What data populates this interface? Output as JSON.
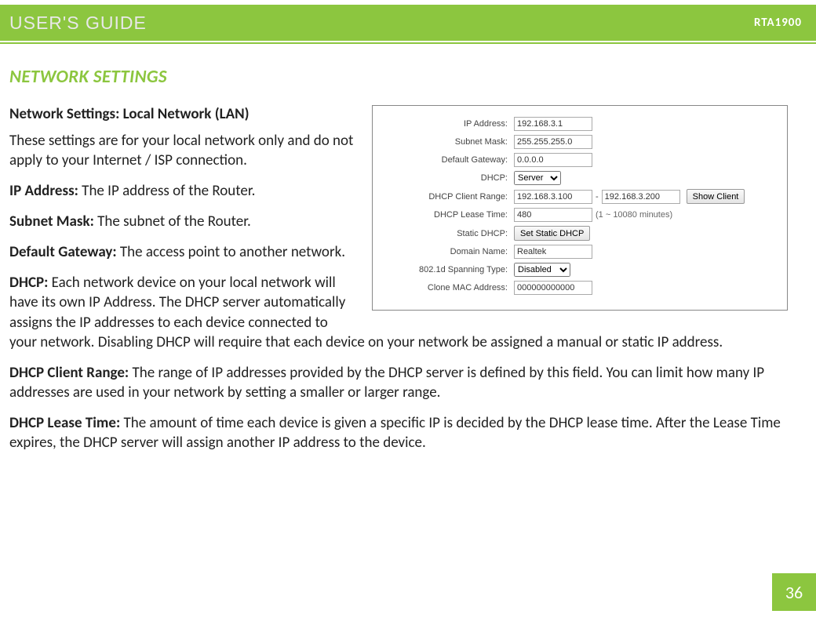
{
  "header": {
    "title": "USER'S GUIDE",
    "model": "RTA1900"
  },
  "section_title": "NETWORK SETTINGS",
  "subheading": "Network Settings: Local Network (LAN)",
  "intro": "These settings are for your local network only and do not apply to your Internet / ISP connection.",
  "defs": {
    "ip_term": "IP Address:",
    "ip_text": " The IP address of the Router.",
    "subnet_term": "Subnet Mask:",
    "subnet_text": " The subnet of the Router.",
    "gateway_term": "Default Gateway:",
    "gateway_text": " The access point to another network.",
    "dhcp_term": "DHCP:",
    "dhcp_text": " Each network device on your local network will have its own IP Address.  The DHCP server automatically assigns the IP addresses to each device connected to your network.  Disabling DHCP will require that each device on your network be assigned a manual or static IP address.",
    "range_term": "DHCP Client Range:",
    "range_text": " The range of IP addresses provided by the DHCP server is defined by this field.  You can limit how many IP addresses are used in your network by setting a smaller or larger range.",
    "lease_term": "DHCP Lease Time:",
    "lease_text": " The amount of time each device is given a specific IP is decided by the DHCP lease time.  After the Lease Time expires, the DHCP server will assign another IP address to the device."
  },
  "form": {
    "ip_label": "IP Address:",
    "ip_value": "192.168.3.1",
    "subnet_label": "Subnet Mask:",
    "subnet_value": "255.255.255.0",
    "gateway_label": "Default Gateway:",
    "gateway_value": "0.0.0.0",
    "dhcp_label": "DHCP:",
    "dhcp_value": "Server",
    "range_label": "DHCP Client Range:",
    "range_start": "192.168.3.100",
    "range_dash": "-",
    "range_end": "192.168.3.200",
    "show_client": "Show Client",
    "lease_label": "DHCP Lease Time:",
    "lease_value": "480",
    "lease_hint": "(1 ~ 10080 minutes)",
    "static_label": "Static DHCP:",
    "static_btn": "Set Static DHCP",
    "domain_label": "Domain Name:",
    "domain_value": "Realtek",
    "spanning_label": "802.1d Spanning Type:",
    "spanning_value": "Disabled",
    "mac_label": "Clone MAC Address:",
    "mac_value": "000000000000"
  },
  "page_number": "36"
}
